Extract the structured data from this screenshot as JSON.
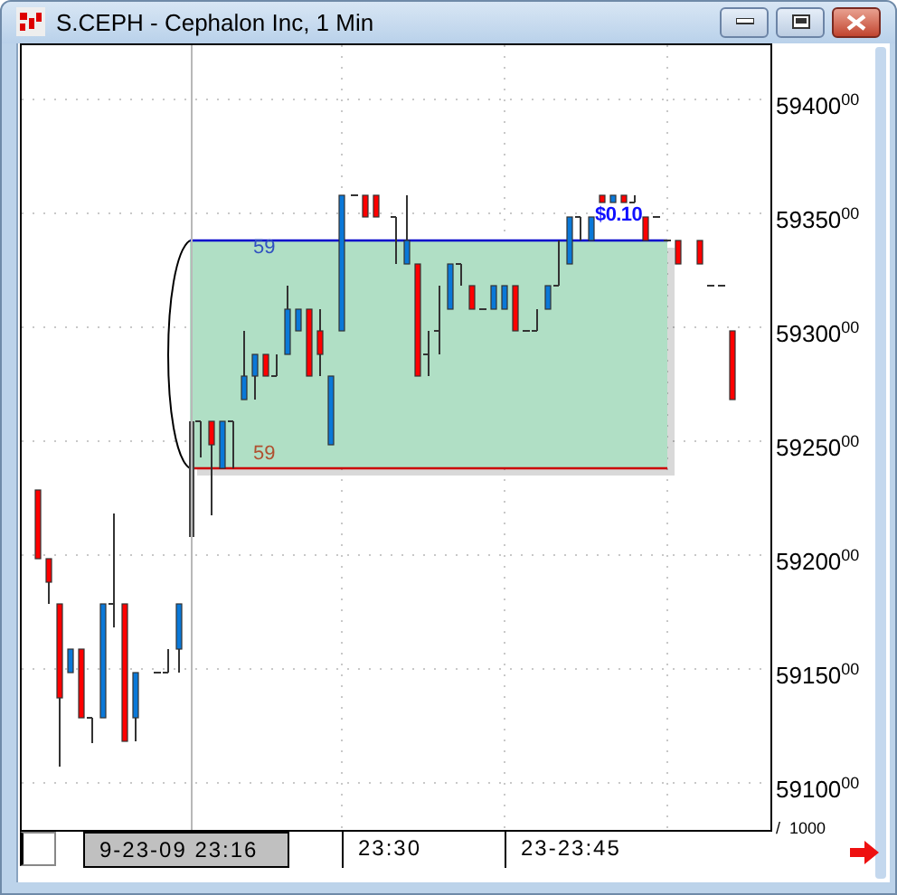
{
  "window": {
    "title": "S.CEPH - Cephalon Inc, 1 Min"
  },
  "zone": {
    "upper_label": "59",
    "lower_label": "59",
    "price_label": "$0.10"
  },
  "price_axis": {
    "labels": [
      "59400$^{00}$",
      "59350$^{00}$",
      "59300$^{00}$",
      "59250$^{00}$",
      "59200$^{00}$",
      "59150$^{00}$",
      "59100$^{00}$"
    ],
    "scale": "/  1000"
  },
  "time_axis": {
    "labels": [
      {
        "text": "9-23-09 23:16",
        "selected": true
      },
      {
        "text": "23:30",
        "selected": false
      },
      {
        "text": "23-23:45",
        "selected": false
      }
    ]
  }
}
